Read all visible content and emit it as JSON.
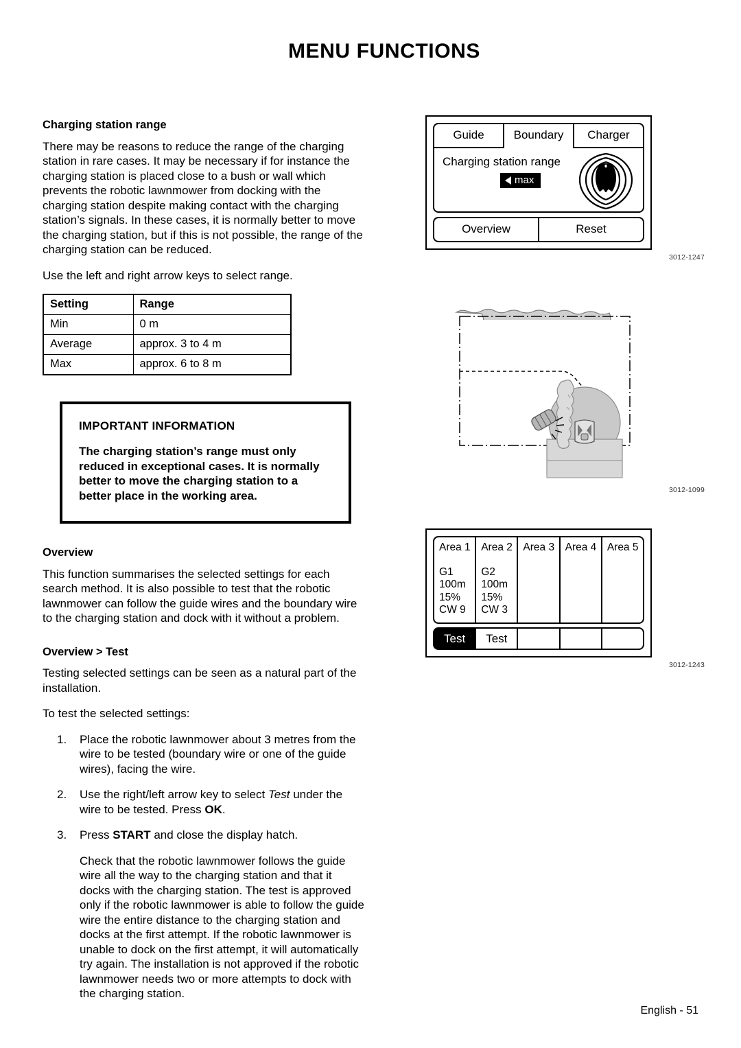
{
  "header": {
    "title": "MENU FUNCTIONS"
  },
  "left": {
    "heading_charging_range": "Charging station range",
    "para_1": "There may be reasons to reduce the range of the charging station in rare cases. It may be necessary if for instance the charging station is placed close to a bush or wall which prevents the robotic lawnmower from docking with the charging station despite making contact with the charging station’s signals. In these cases, it is normally better to move the charging station, but if this is not possible, the range of the charging station can be reduced.",
    "para_2": "Use the left and right arrow keys to select range.",
    "table": {
      "headers": [
        "Setting",
        "Range"
      ],
      "rows": [
        [
          "Min",
          "0 m"
        ],
        [
          "Average",
          "approx. 3 to 4 m"
        ],
        [
          "Max",
          "approx. 6 to 8 m"
        ]
      ]
    },
    "important": {
      "title": "IMPORTANT INFORMATION",
      "body": "The charging station’s range must only reduced in exceptional cases. It is normally better to move the charging station to a better place in the working area."
    },
    "heading_overview": "Overview",
    "para_overview": "This function summarises the selected settings for each search method. It is also possible to test that the robotic lawnmower can follow the guide wires and the boundary wire to the charging station and dock with it without a problem.",
    "heading_overview_test": "Overview > Test",
    "para_testing": "Testing selected settings can be seen as a natural part of the installation.",
    "para_to_test": "To test the selected settings:",
    "steps": [
      {
        "num": "1.",
        "text": "Place the robotic lawnmower about 3 metres from the wire to be tested (boundary wire or one of the guide wires), facing the wire."
      },
      {
        "num": "2.",
        "text_before": "Use the right/left arrow key to select ",
        "italic": "Test",
        "text_middle": " under the wire to be tested. Press ",
        "bold": "OK",
        "text_after": "."
      },
      {
        "num": "3.",
        "text_before": "Press ",
        "bold": "START",
        "text_after": " and close the display hatch."
      }
    ],
    "para_check": "Check that the robotic lawnmower follows the guide wire all the way to the charging station and that it docks with the charging station. The test is approved only if the robotic lawnmower is able to follow the guide wire the entire distance to the charging station and docks at the first attempt. If the robotic lawnmower is unable to dock on the first attempt, it will automatically try again. The installation is not approved if the robotic lawnmower needs two or more attempts to dock with the charging station."
  },
  "right": {
    "figure_range": {
      "tabs": [
        "Guide",
        "Boundary",
        "Charger"
      ],
      "selected_tab": "Boundary",
      "content_label": "Charging station range",
      "value": "max",
      "buttons": [
        "Overview",
        "Reset"
      ],
      "caption": "3012-1247"
    },
    "figure_garden": {
      "caption": "3012-1099"
    },
    "figure_overview": {
      "areas": [
        {
          "title": "Area 1",
          "lines": [
            "G1",
            "100m",
            "15%",
            "CW 9"
          ],
          "test": "Test",
          "selected": true
        },
        {
          "title": "Area 2",
          "lines": [
            "G2",
            "100m",
            "15%",
            "CW 3"
          ],
          "test": "Test",
          "selected": false
        },
        {
          "title": "Area 3",
          "lines": [],
          "test": "",
          "selected": false
        },
        {
          "title": "Area 4",
          "lines": [],
          "test": "",
          "selected": false
        },
        {
          "title": "Area 5",
          "lines": [],
          "test": "",
          "selected": false
        }
      ],
      "caption": "3012-1243"
    }
  },
  "footer": {
    "page_label": "English - 51"
  },
  "colors": {
    "ink": "#000000",
    "paper": "#ffffff",
    "illustration_gray": "#c9c9c9",
    "illustration_light": "#dcdcdc",
    "caption_gray": "#333333"
  }
}
